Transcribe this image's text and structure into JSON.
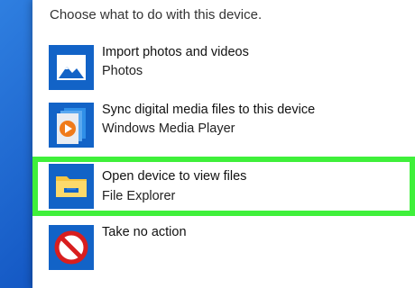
{
  "prompt": "Choose what to do with this device.",
  "options": [
    {
      "label": "Import photos and videos",
      "sub": "Photos",
      "icon": "photos-icon",
      "highlighted": false
    },
    {
      "label": "Sync digital media files to this device",
      "sub": "Windows Media Player",
      "icon": "media-player-icon",
      "highlighted": false
    },
    {
      "label": "Open device to view files",
      "sub": "File Explorer",
      "icon": "folder-icon",
      "highlighted": true
    },
    {
      "label": "Take no action",
      "sub": "",
      "icon": "no-action-icon",
      "highlighted": false
    }
  ],
  "colors": {
    "highlight": "#3ff03a",
    "tile": "#1263c7",
    "desktop": "#1f6fd6"
  }
}
